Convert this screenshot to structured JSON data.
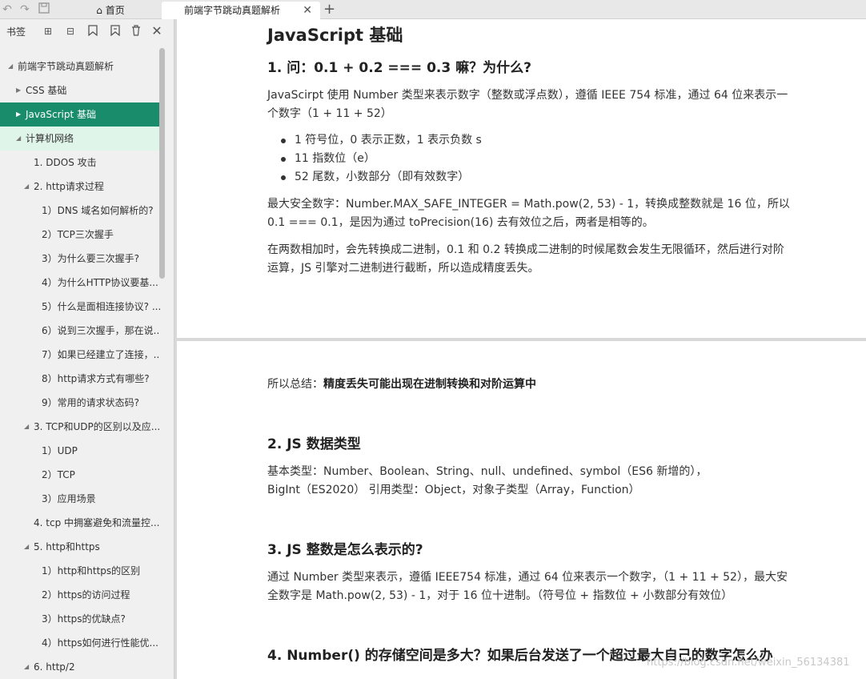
{
  "tabs": {
    "home_label": "首页",
    "active_label": "前端字节跳动真题解析",
    "close_glyph": "✕",
    "add_glyph": "+"
  },
  "sidebar": {
    "title": "书签",
    "items": [
      {
        "label": "前端字节跳动真题解析",
        "level": 0,
        "arrow": "◢",
        "state": "normal"
      },
      {
        "label": "CSS 基础",
        "level": 1,
        "arrow": "▶",
        "state": "normal"
      },
      {
        "label": "JavaScript 基础",
        "level": 1,
        "arrow": "▶",
        "state": "selected"
      },
      {
        "label": "计算机网络",
        "level": 1,
        "arrow": "◢",
        "state": "hover"
      },
      {
        "label": "1. DDOS 攻击",
        "level": 2,
        "arrow": "",
        "state": "normal"
      },
      {
        "label": "2. http请求过程",
        "level": 2,
        "arrow": "◢",
        "state": "normal"
      },
      {
        "label": "1）DNS 域名如何解析的?",
        "level": 3,
        "arrow": "",
        "state": "normal"
      },
      {
        "label": "2）TCP三次握手",
        "level": 3,
        "arrow": "",
        "state": "normal"
      },
      {
        "label": "3）为什么要三次握手?",
        "level": 3,
        "arrow": "",
        "state": "normal"
      },
      {
        "label": "4）为什么HTTP协议要基...",
        "level": 3,
        "arrow": "",
        "state": "normal"
      },
      {
        "label": "5）什么是面相连接协议? ...",
        "level": 3,
        "arrow": "",
        "state": "normal"
      },
      {
        "label": "6）说到三次握手，那在说...",
        "level": 3,
        "arrow": "",
        "state": "normal"
      },
      {
        "label": "7）如果已经建立了连接，...",
        "level": 3,
        "arrow": "",
        "state": "normal"
      },
      {
        "label": "8）http请求方式有哪些?",
        "level": 3,
        "arrow": "",
        "state": "normal"
      },
      {
        "label": "9）常用的请求状态码?",
        "level": 3,
        "arrow": "",
        "state": "normal"
      },
      {
        "label": "3. TCP和UDP的区别以及应...",
        "level": 2,
        "arrow": "◢",
        "state": "normal"
      },
      {
        "label": "1）UDP",
        "level": 3,
        "arrow": "",
        "state": "normal"
      },
      {
        "label": "2）TCP",
        "level": 3,
        "arrow": "",
        "state": "normal"
      },
      {
        "label": "3）应用场景",
        "level": 3,
        "arrow": "",
        "state": "normal"
      },
      {
        "label": "4. tcp 中拥塞避免和流量控...",
        "level": 2,
        "arrow": "",
        "state": "normal"
      },
      {
        "label": "5. http和https",
        "level": 2,
        "arrow": "◢",
        "state": "normal"
      },
      {
        "label": "1）http和https的区别",
        "level": 3,
        "arrow": "",
        "state": "normal"
      },
      {
        "label": "2）https的访问过程",
        "level": 3,
        "arrow": "",
        "state": "normal"
      },
      {
        "label": "3）https的优缺点?",
        "level": 3,
        "arrow": "",
        "state": "normal"
      },
      {
        "label": "4）https如何进行性能优...",
        "level": 3,
        "arrow": "",
        "state": "normal"
      },
      {
        "label": "6. http/2",
        "level": 2,
        "arrow": "◢",
        "state": "normal"
      }
    ]
  },
  "doc": {
    "page1": {
      "title": "JavaScript 基础",
      "q1_heading": "1. 问：0.1 + 0.2 === 0.3 嘛？为什么?",
      "q1_para1_line1": "JavaScirpt 使用 Number 类型来表示数字（整数或浮点数），遵循 IEEE 754 标准，通过 64 位来表示一",
      "q1_para1_line2": "个数字（1 + 11 + 52）",
      "bullets": [
        "1 符号位，0 表示正数，1 表示负数 s",
        "11 指数位（e）",
        "52 尾数，小数部分（即有效数字）"
      ],
      "para2_line1": "最大安全数字：Number.MAX_SAFE_INTEGER = Math.pow(2, 53) - 1，转换成整数就是 16 位，所以",
      "para2_line2": "0.1 === 0.1，是因为通过 toPrecision(16) 去有效位之后，两者是相等的。",
      "para3_line1": "在两数相加时，会先转换成二进制，0.1 和 0.2 转换成二进制的时候尾数会发生无限循环，然后进行对阶",
      "para3_line2": "运算，JS 引擎对二进制进行截断，所以造成精度丢失。"
    },
    "page2": {
      "summary_prefix": "所以总结：",
      "summary_bold": "精度丢失可能出现在进制转换和对阶运算中",
      "q2_heading": "2. JS 数据类型",
      "q2_line1": "基本类型：Number、Boolean、String、null、undefined、symbol（ES6 新增的），",
      "q2_line2": "BigInt（ES2020） 引用类型：Object，对象子类型（Array，Function）",
      "q3_heading": "3. JS 整数是怎么表示的?",
      "q3_line1": "通过 Number 类型来表示，遵循 IEEE754 标准，通过 64 位来表示一个数字，（1 + 11 + 52），最大安",
      "q3_line2": "全数字是 Math.pow(2, 53) - 1，对于 16 位十进制。（符号位 + 指数位 + 小数部分有效位）",
      "q4_heading": "4. Number() 的存储空间是多大？如果后台发送了一个超过最大自己的数字怎么办"
    }
  },
  "watermark": "https://blog.csdn.net/weixin_56134381"
}
